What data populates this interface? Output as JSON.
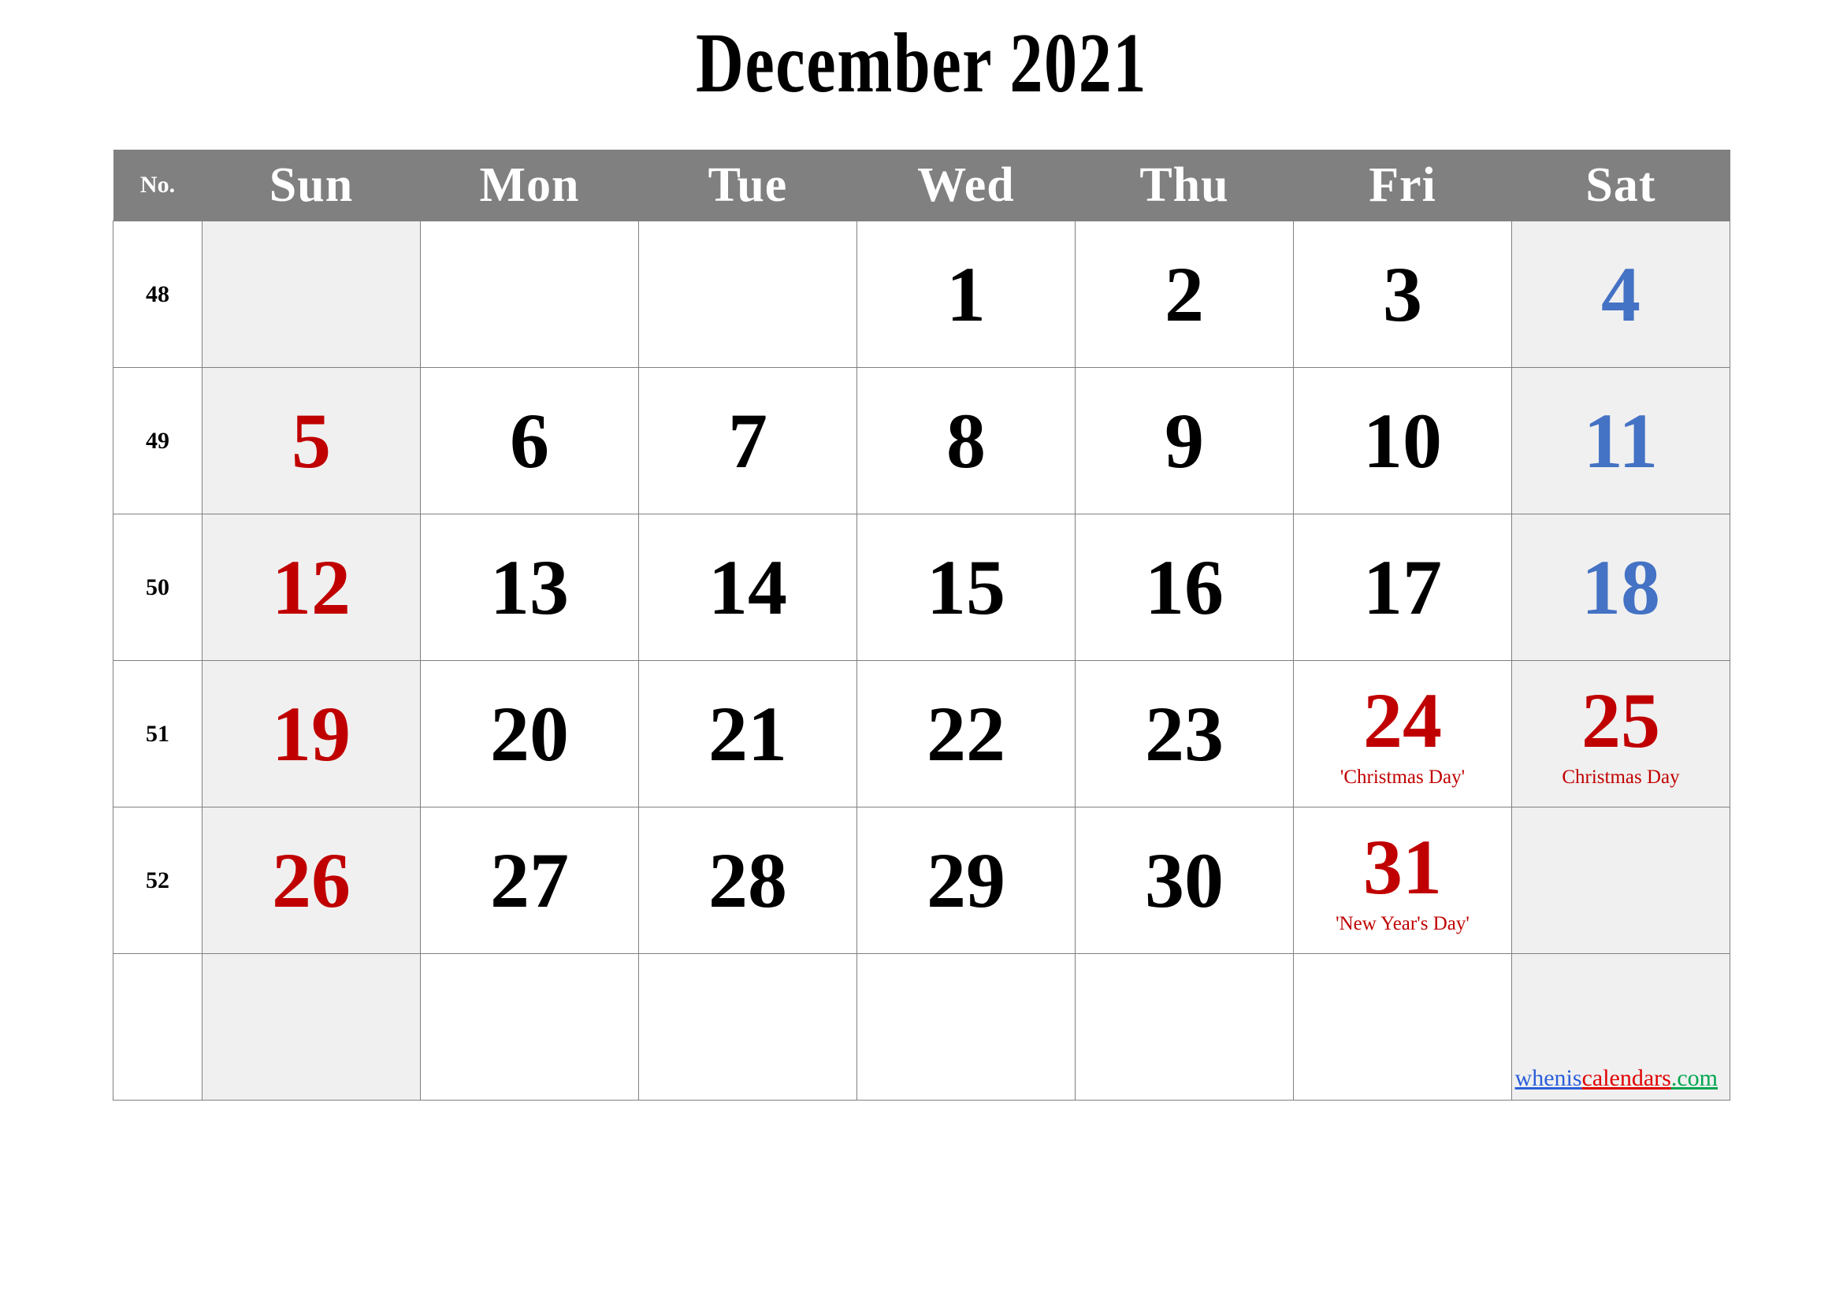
{
  "title": "December 2021",
  "colors": {
    "header_bg": "#808080",
    "header_text": "#ffffff",
    "weekend_cell_bg": "#f0f0f0",
    "sunday_text": "#c00000",
    "saturday_text": "#4472c4",
    "holiday_text": "#c00000",
    "grid_line": "#808080",
    "body_text": "#000000"
  },
  "header": {
    "week_no_label": "No.",
    "days": [
      "Sun",
      "Mon",
      "Tue",
      "Wed",
      "Thu",
      "Fri",
      "Sat"
    ]
  },
  "weeks": [
    {
      "no": "48",
      "cells": [
        {
          "day": "",
          "note": "",
          "kind": "empty"
        },
        {
          "day": "",
          "note": "",
          "kind": "empty"
        },
        {
          "day": "",
          "note": "",
          "kind": "empty"
        },
        {
          "day": "1",
          "note": "",
          "kind": "weekday"
        },
        {
          "day": "2",
          "note": "",
          "kind": "weekday"
        },
        {
          "day": "3",
          "note": "",
          "kind": "weekday"
        },
        {
          "day": "4",
          "note": "",
          "kind": "saturday"
        }
      ]
    },
    {
      "no": "49",
      "cells": [
        {
          "day": "5",
          "note": "",
          "kind": "sunday"
        },
        {
          "day": "6",
          "note": "",
          "kind": "weekday"
        },
        {
          "day": "7",
          "note": "",
          "kind": "weekday"
        },
        {
          "day": "8",
          "note": "",
          "kind": "weekday"
        },
        {
          "day": "9",
          "note": "",
          "kind": "weekday"
        },
        {
          "day": "10",
          "note": "",
          "kind": "weekday"
        },
        {
          "day": "11",
          "note": "",
          "kind": "saturday"
        }
      ]
    },
    {
      "no": "50",
      "cells": [
        {
          "day": "12",
          "note": "",
          "kind": "sunday"
        },
        {
          "day": "13",
          "note": "",
          "kind": "weekday"
        },
        {
          "day": "14",
          "note": "",
          "kind": "weekday"
        },
        {
          "day": "15",
          "note": "",
          "kind": "weekday"
        },
        {
          "day": "16",
          "note": "",
          "kind": "weekday"
        },
        {
          "day": "17",
          "note": "",
          "kind": "weekday"
        },
        {
          "day": "18",
          "note": "",
          "kind": "saturday"
        }
      ]
    },
    {
      "no": "51",
      "cells": [
        {
          "day": "19",
          "note": "",
          "kind": "sunday"
        },
        {
          "day": "20",
          "note": "",
          "kind": "weekday"
        },
        {
          "day": "21",
          "note": "",
          "kind": "weekday"
        },
        {
          "day": "22",
          "note": "",
          "kind": "weekday"
        },
        {
          "day": "23",
          "note": "",
          "kind": "weekday"
        },
        {
          "day": "24",
          "note": "'Christmas Day'",
          "kind": "holiday"
        },
        {
          "day": "25",
          "note": "Christmas Day",
          "kind": "holiday-sat"
        }
      ]
    },
    {
      "no": "52",
      "cells": [
        {
          "day": "26",
          "note": "",
          "kind": "sunday"
        },
        {
          "day": "27",
          "note": "",
          "kind": "weekday"
        },
        {
          "day": "28",
          "note": "",
          "kind": "weekday"
        },
        {
          "day": "29",
          "note": "",
          "kind": "weekday"
        },
        {
          "day": "30",
          "note": "",
          "kind": "weekday"
        },
        {
          "day": "31",
          "note": "'New Year's Day'",
          "kind": "holiday"
        },
        {
          "day": "",
          "note": "",
          "kind": "empty-sat"
        }
      ]
    },
    {
      "no": "",
      "cells": [
        {
          "day": "",
          "note": "",
          "kind": "empty-sun"
        },
        {
          "day": "",
          "note": "",
          "kind": "empty"
        },
        {
          "day": "",
          "note": "",
          "kind": "empty"
        },
        {
          "day": "",
          "note": "",
          "kind": "empty"
        },
        {
          "day": "",
          "note": "",
          "kind": "empty"
        },
        {
          "day": "",
          "note": "",
          "kind": "empty"
        },
        {
          "day": "",
          "note": "",
          "kind": "empty-sat"
        }
      ]
    }
  ],
  "watermark": {
    "part1": "whenis",
    "part2": "calendars",
    "part3": ".com"
  }
}
